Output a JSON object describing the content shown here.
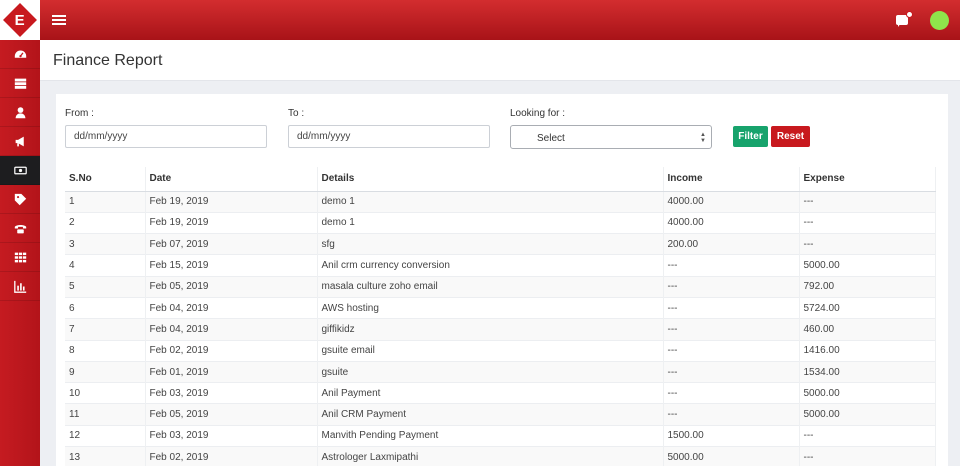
{
  "brand": {
    "logo_letter": "E"
  },
  "sidebar": {
    "items": [
      {
        "icon": "dashboard-icon"
      },
      {
        "icon": "server-icon"
      },
      {
        "icon": "user-icon"
      },
      {
        "icon": "megaphone-icon"
      },
      {
        "icon": "money-icon",
        "active": true
      },
      {
        "icon": "tag-icon"
      },
      {
        "icon": "phone-icon"
      },
      {
        "icon": "grid-icon"
      },
      {
        "icon": "bar-chart-icon"
      }
    ]
  },
  "page": {
    "title": "Finance Report"
  },
  "filters": {
    "from_label": "From :",
    "from_placeholder": "dd/mm/yyyy",
    "to_label": "To :",
    "to_placeholder": "dd/mm/yyyy",
    "looking_for_label": "Looking for :",
    "looking_for_value": "Select",
    "filter_button": "Filter",
    "reset_button": "Reset"
  },
  "table": {
    "headers": [
      "S.No",
      "Date",
      "Details",
      "Income",
      "Expense"
    ],
    "rows": [
      [
        "1",
        "Feb 19, 2019",
        "demo 1",
        "4000.00",
        "---"
      ],
      [
        "2",
        "Feb 19, 2019",
        "demo 1",
        "4000.00",
        "---"
      ],
      [
        "3",
        "Feb 07, 2019",
        "sfg",
        "200.00",
        "---"
      ],
      [
        "4",
        "Feb 15, 2019",
        "Anil crm currency conversion",
        "---",
        "5000.00"
      ],
      [
        "5",
        "Feb 05, 2019",
        "masala culture zoho email",
        "---",
        "792.00"
      ],
      [
        "6",
        "Feb 04, 2019",
        "AWS hosting",
        "---",
        "5724.00"
      ],
      [
        "7",
        "Feb 04, 2019",
        "giffikidz",
        "---",
        "460.00"
      ],
      [
        "8",
        "Feb 02, 2019",
        "gsuite email",
        "---",
        "1416.00"
      ],
      [
        "9",
        "Feb 01, 2019",
        "gsuite",
        "---",
        "1534.00"
      ],
      [
        "10",
        "Feb 03, 2019",
        "Anil Payment",
        "---",
        "5000.00"
      ],
      [
        "11",
        "Feb 05, 2019",
        "Anil CRM Payment",
        "---",
        "5000.00"
      ],
      [
        "12",
        "Feb 03, 2019",
        "Manvith Pending Payment",
        "1500.00",
        "---"
      ],
      [
        "13",
        "Feb 02, 2019",
        "Astrologer Laxmipathi",
        "5000.00",
        "---"
      ]
    ]
  },
  "colors": {
    "brand_red": "#c8191e",
    "filter_green": "#17a36c",
    "avatar_green": "#8fe44b"
  }
}
